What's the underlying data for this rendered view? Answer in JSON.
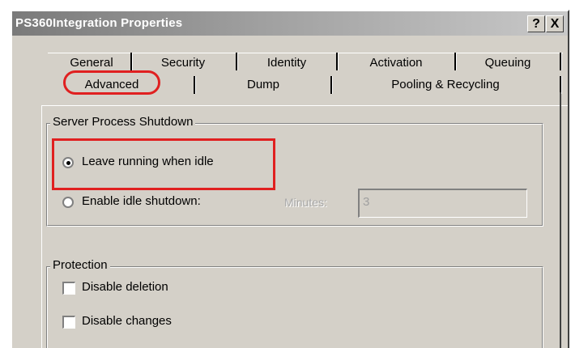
{
  "window": {
    "title": "PS360Integration Properties",
    "help_label": "?",
    "close_label": "X"
  },
  "tabs": {
    "row1": [
      "General",
      "Security",
      "Identity",
      "Activation",
      "Queuing"
    ],
    "row2": [
      "Advanced",
      "Dump",
      "Pooling & Recycling"
    ],
    "active": "Advanced"
  },
  "server_process_shutdown": {
    "label": "Server Process Shutdown",
    "option_leave_running": {
      "label": "Leave running when idle",
      "selected": true
    },
    "option_enable_idle_shutdown": {
      "label": "Enable idle shutdown:",
      "selected": false
    },
    "minutes_label": "Minutes:",
    "minutes_value": "3"
  },
  "protection": {
    "label": "Protection",
    "disable_deletion": {
      "label": "Disable deletion",
      "checked": false
    },
    "disable_changes": {
      "label": "Disable changes",
      "checked": false
    }
  },
  "colors": {
    "dialog_face": "#d4d0c8",
    "annotation_red": "#e02020"
  }
}
